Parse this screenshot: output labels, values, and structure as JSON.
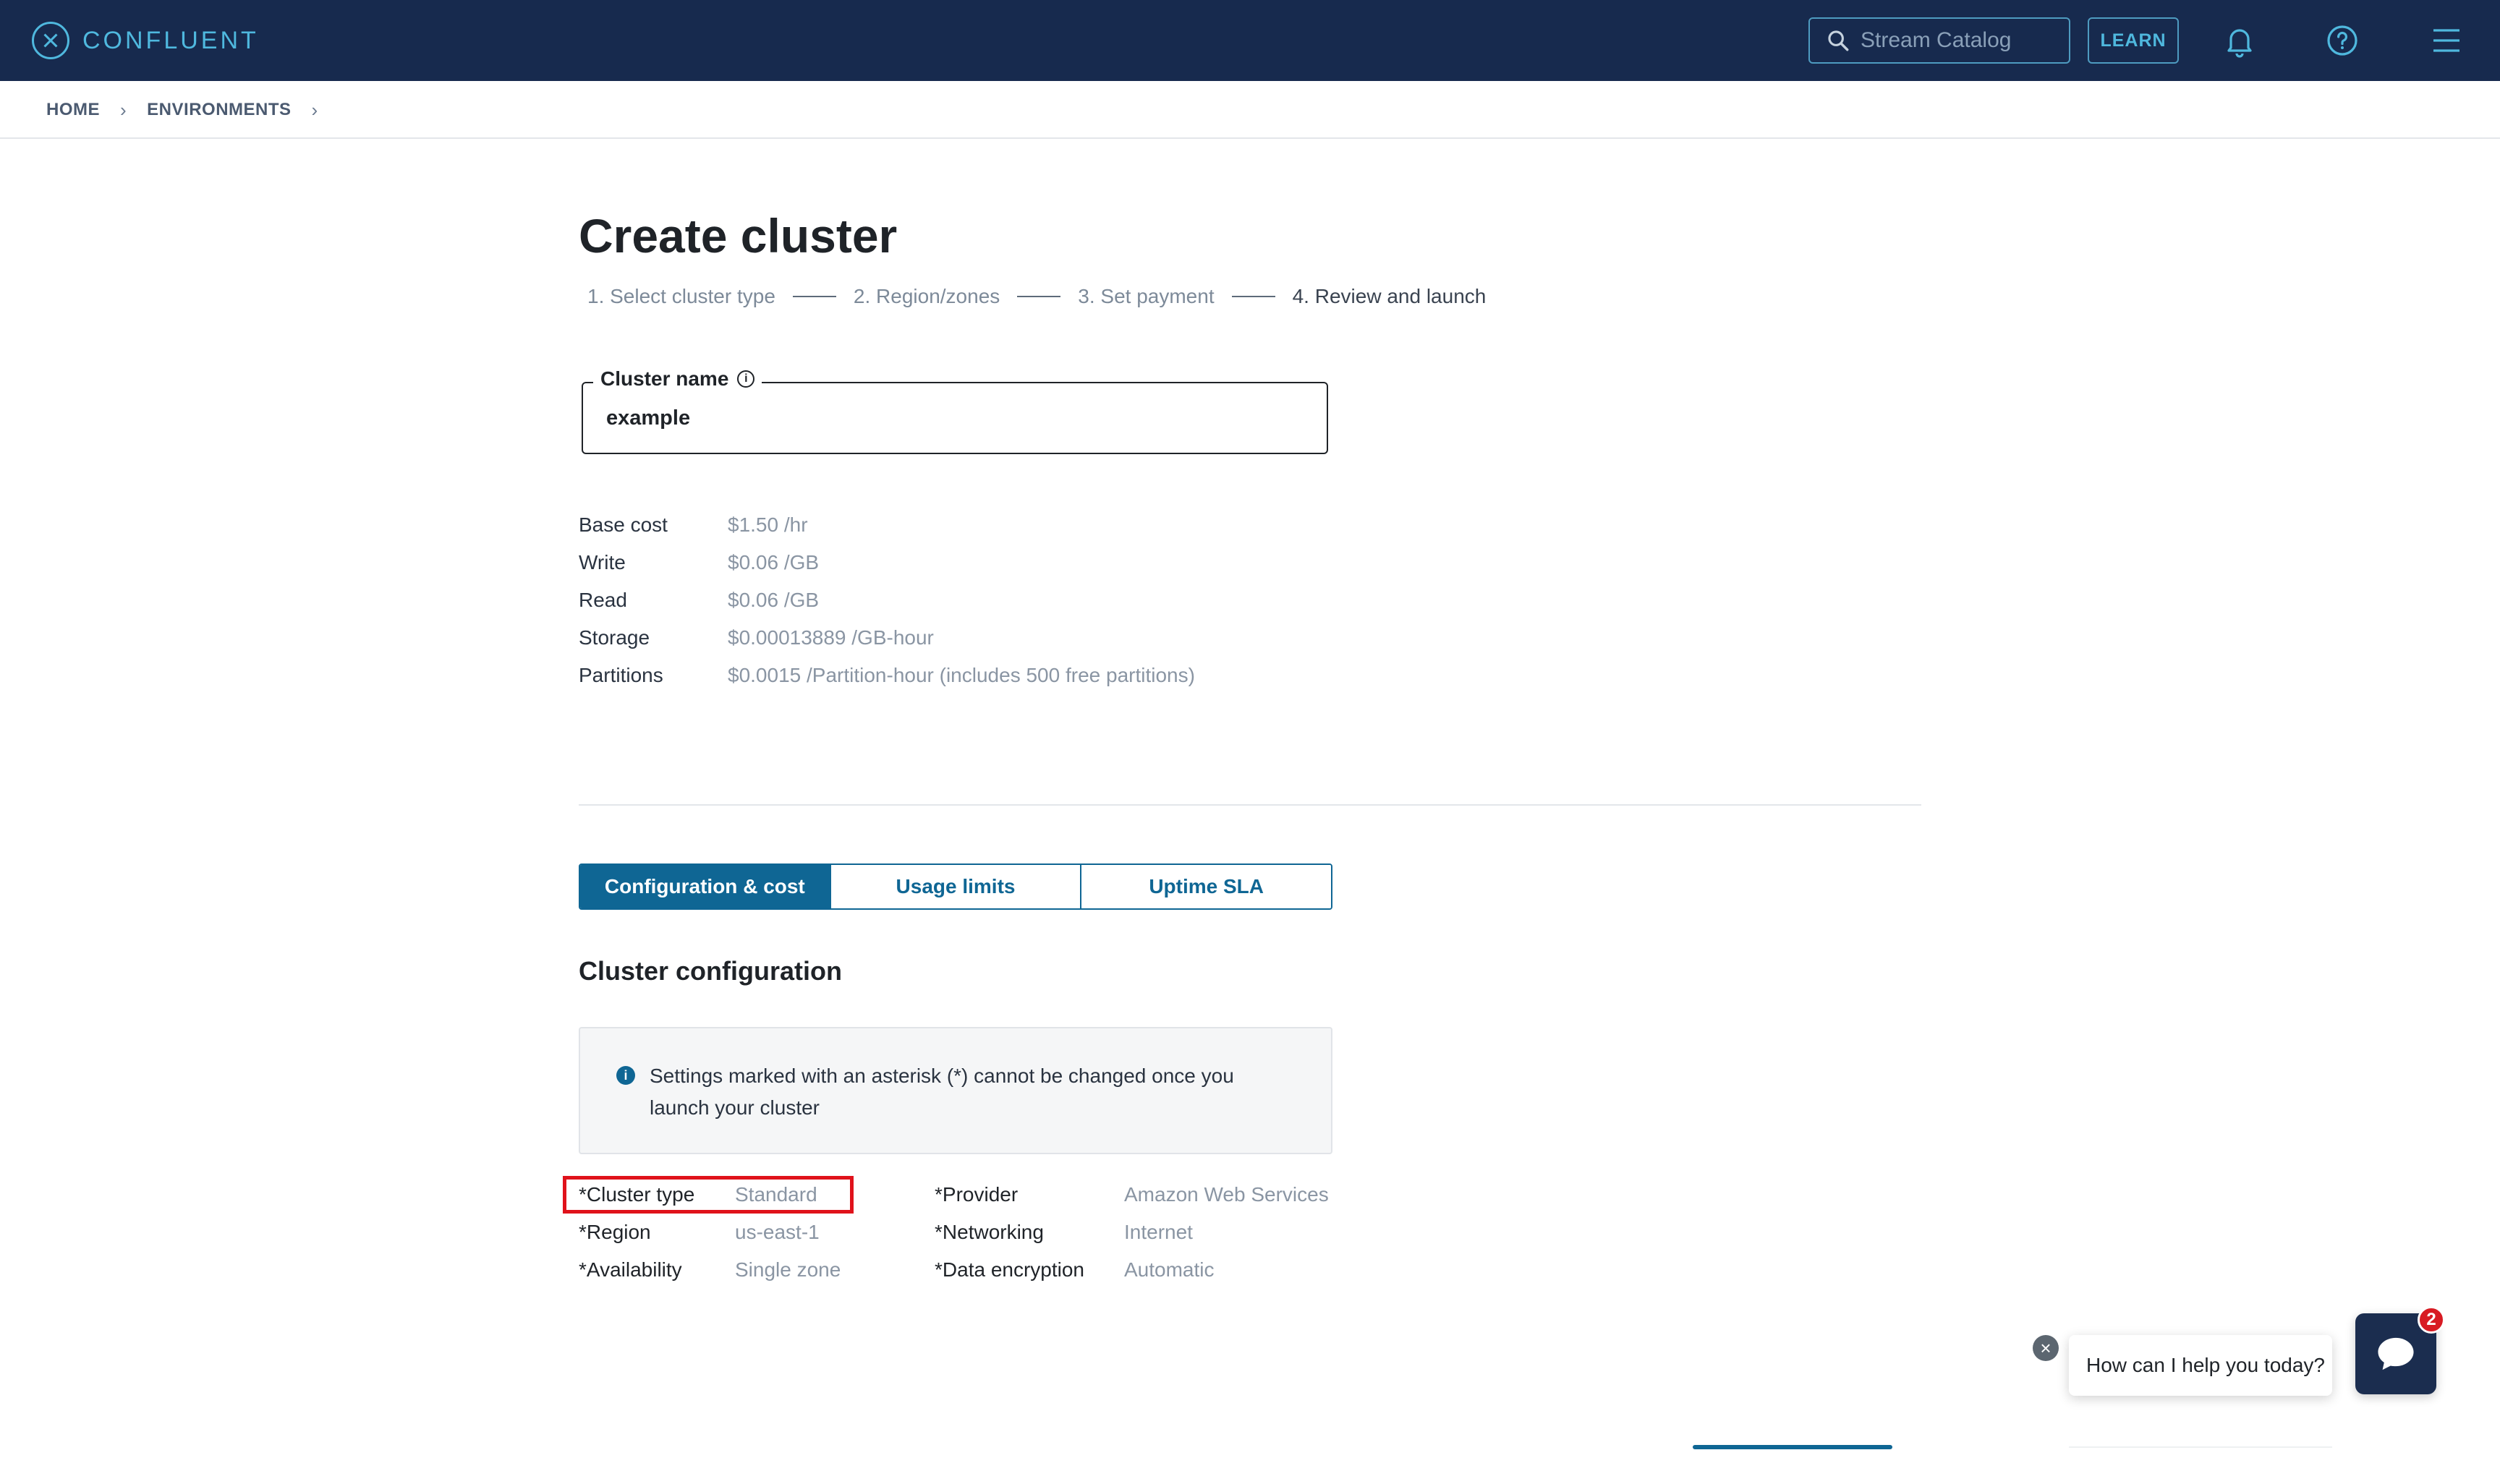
{
  "header": {
    "logo_text": "CONFLUENT",
    "search_placeholder": "Stream Catalog",
    "learn_label": "LEARN",
    "icons": [
      "search-icon",
      "bell-icon",
      "help-icon",
      "hamburger-menu-icon"
    ],
    "colors": {
      "nav_bg": "#172a4e",
      "accent": "#4fb8de"
    }
  },
  "breadcrumb": {
    "home": "HOME",
    "environments": "ENVIRONMENTS"
  },
  "page": {
    "title": "Create cluster",
    "steps": [
      "1. Select cluster type",
      "2. Region/zones",
      "3. Set payment",
      "4. Review and launch"
    ],
    "current_step": 4
  },
  "cluster_name": {
    "label": "Cluster name",
    "value": "example"
  },
  "pricing": [
    {
      "label": "Base cost",
      "value": "$1.50 /hr"
    },
    {
      "label": "Write",
      "value": "$0.06 /GB"
    },
    {
      "label": "Read",
      "value": "$0.06 /GB"
    },
    {
      "label": "Storage",
      "value": "$0.00013889 /GB-hour"
    },
    {
      "label": "Partitions",
      "value": "$0.0015 /Partition-hour (includes 500 free partitions)"
    }
  ],
  "tabs": [
    {
      "label": "Configuration & cost",
      "active": true
    },
    {
      "label": "Usage limits",
      "active": false
    },
    {
      "label": "Uptime SLA",
      "active": false
    }
  ],
  "config": {
    "title": "Cluster configuration",
    "notice": "Settings marked with an asterisk (*) cannot be changed once you launch your cluster",
    "left": [
      {
        "label": "*Cluster type",
        "value": "Standard"
      },
      {
        "label": "*Region",
        "value": "us-east-1"
      },
      {
        "label": "*Availability",
        "value": "Single zone"
      }
    ],
    "right": [
      {
        "label": "*Provider",
        "value": "Amazon Web Services"
      },
      {
        "label": "*Networking",
        "value": "Internet"
      },
      {
        "label": "*Data encryption",
        "value": "Automatic"
      }
    ]
  },
  "chat": {
    "prompt": "How can I help you today?",
    "badge_count": "2",
    "close_glyph": "×"
  }
}
